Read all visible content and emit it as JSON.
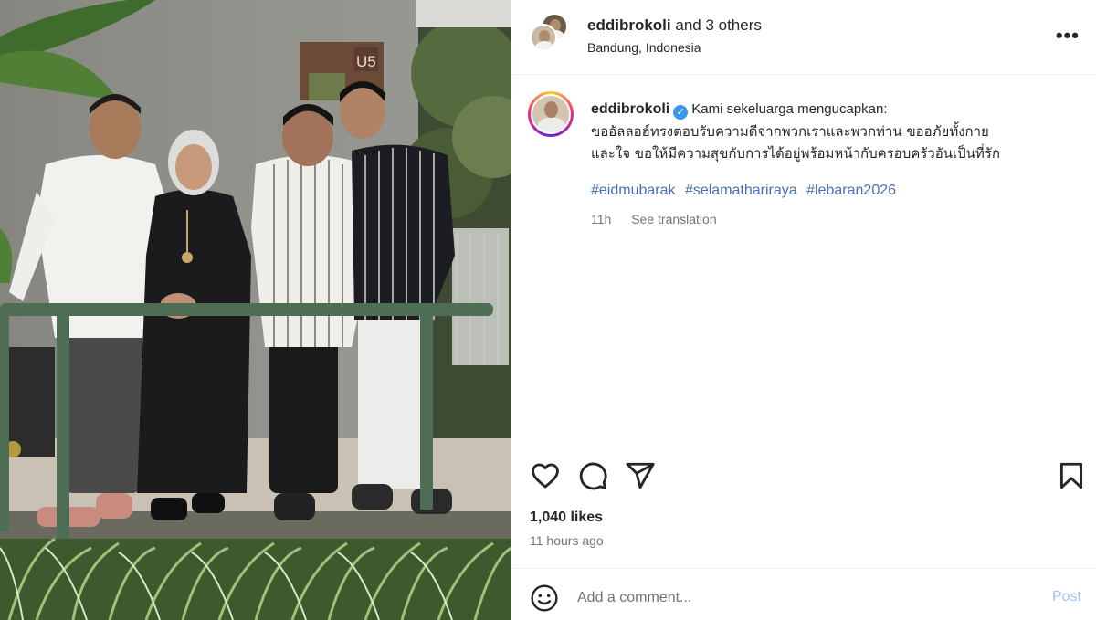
{
  "header": {
    "username": "eddibrokoli",
    "others": "and 3 others",
    "location": "Bandung, Indonesia",
    "more": "•••"
  },
  "photo": {
    "sign": "U5"
  },
  "caption": {
    "username": "eddibrokoli",
    "verified_mark": "✓",
    "intro": "Kami sekeluarga mengucapkan:",
    "thai_line1": "ขออัลลอฮ์ทรงตอบรับความดีจากพวกเราและพวกท่าน ขออภัยทั้งกาย",
    "thai_line2": "และใจ ขอให้มีความสุขกับการได้อยู่พร้อมหน้ากับครอบครัวอันเป็นที่รัก",
    "hashtags": [
      "#eidmubarak",
      "#selamathariraya",
      "#lebaran2026"
    ],
    "age": "11h",
    "see_translation": "See translation"
  },
  "actions": {
    "icons": [
      "heart-icon",
      "comment-icon",
      "share-icon",
      "bookmark-icon"
    ]
  },
  "likes": "1,040 likes",
  "posted": "11 hours ago",
  "comment": {
    "placeholder": "Add a comment...",
    "post_label": "Post"
  },
  "colors": {
    "hashtag": "#4a6fb5",
    "verified": "#3897f0",
    "post_disabled": "#9dc4f5",
    "muted": "#737373"
  }
}
